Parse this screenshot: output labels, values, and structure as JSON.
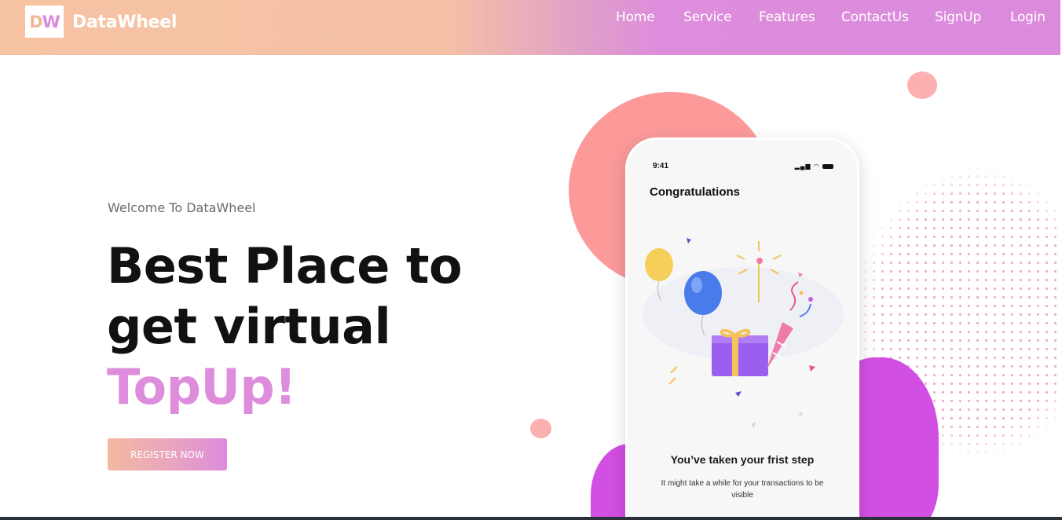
{
  "brand": {
    "logo_d": "D",
    "logo_w": "W",
    "name": "DataWheel"
  },
  "nav": {
    "items": [
      {
        "label": "Home"
      },
      {
        "label": "Service"
      },
      {
        "label": "Features"
      },
      {
        "label": "ContactUs"
      },
      {
        "label": "SignUp"
      },
      {
        "label": "Login"
      }
    ]
  },
  "hero": {
    "welcome": "Welcome To DataWheel",
    "line1": "Best Place to",
    "line2": "get virtual",
    "accent": "TopUp!",
    "cta": "REGISTER NOW"
  },
  "phone": {
    "time": "9:41",
    "title": "Congratulations",
    "step_title": "You’ve taken your frist step",
    "step_sub": "It might take a while for your transactions to be visible"
  },
  "colors": {
    "accent": "#dd8ddb",
    "peach": "#f6c3a3",
    "coral": "#fc9a9a",
    "purple": "#d24fe3"
  }
}
